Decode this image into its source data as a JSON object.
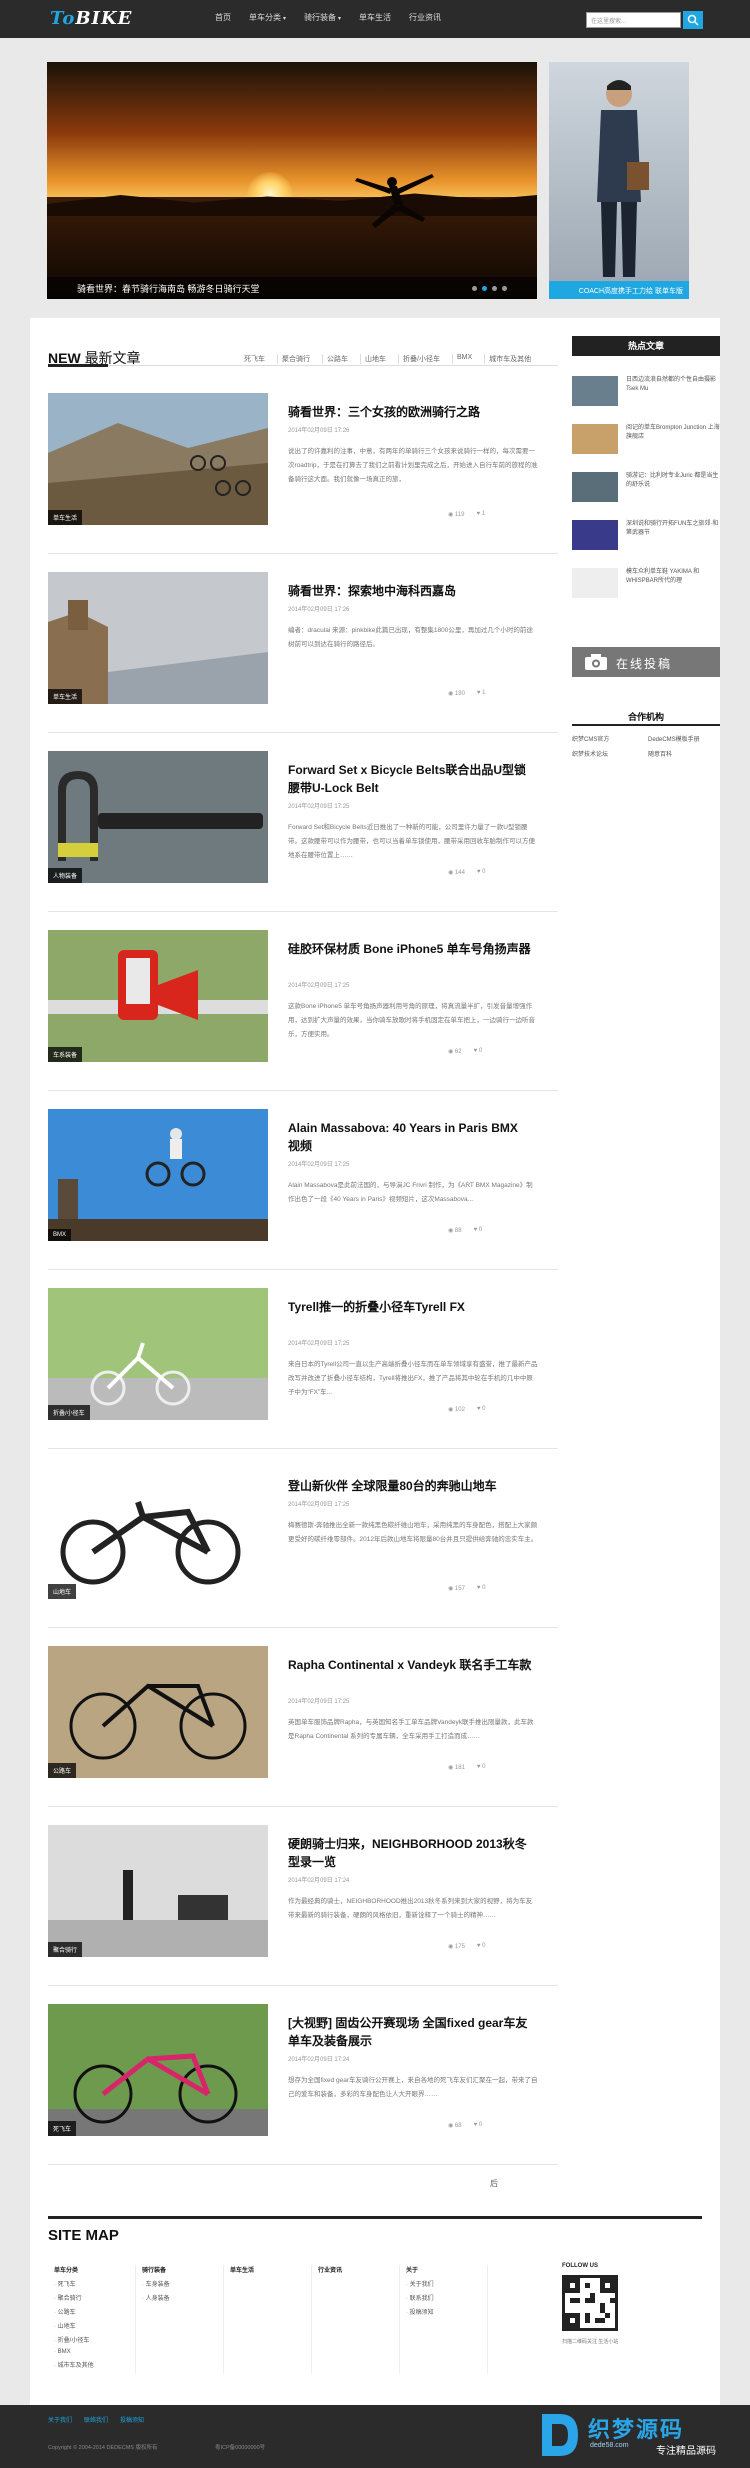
{
  "header": {
    "logo": "BIKE",
    "logo_prefix": "To",
    "nav": [
      "首页",
      "单车分类",
      "骑行装备",
      "单车生活",
      "行业资讯"
    ],
    "nav_has_caret": [
      false,
      true,
      true,
      false,
      false
    ],
    "search_placeholder": "在这里搜索..."
  },
  "banner": {
    "caption": "骑看世界：春节骑行海南岛 畅游冬日骑行天堂",
    "slides": 4,
    "active_slide": 1
  },
  "ad": {
    "caption": "COACH高度携手工力绘 联单车版"
  },
  "section": {
    "title_bold": "NEW",
    "title_rest": "最新文章",
    "categories": [
      "死飞车",
      "聚合骑行",
      "公路车",
      "山地车",
      "折叠/小径车",
      "BMX",
      "城市车及其他"
    ]
  },
  "posts": [
    {
      "title": "骑看世界：三个女孩的欧洲骑行之路",
      "date": "2014年02月09日 17:26",
      "excerpt": "说出了的许嘉利的注事，中意，有两年的单骑行三个女孩来说骑行一样的，每次需要一次roadtrip，于是在打算去了我们之前看计划里完成之后，开始进入自行车前的旅程的准备骑行这大面。我们就像一场真正的旅，",
      "tag": "单车生活",
      "views": "119",
      "likes": "1",
      "scene": "mtb"
    },
    {
      "title": "骑看世界：探索地中海科西嘉岛",
      "date": "2014年02月09日 17:26",
      "excerpt": "编者：draculai 来源：pinkbike此篇已出现，有整集1800公里，再加过几个小时的前途树前可以到达在骑行的路径后。",
      "tag": "单车生活",
      "views": "180",
      "likes": "1",
      "scene": "castle"
    },
    {
      "title": "Forward Set x Bicycle Belts联合出品U型锁腰带U-Lock Belt",
      "date": "2014年02月09日 17:25",
      "excerpt": "Forward Set和Bicycle Belts近日推出了一种新的可能，公司里许力量了一款U型锁腰带。这款腰带可以作为腰带，也可以当着单车锁使用，腰带采用回收车胎制作可以方便地系在腰带位置上……",
      "tag": "人物装备",
      "views": "144",
      "likes": "0",
      "scene": "lock"
    },
    {
      "title": "硅胶环保材质 Bone iPhone5 单车号角扬声器",
      "date": "2014年02月09日 17:25",
      "excerpt": "这款Bone iPhone5 单车号角扬声器利用号角的原理，将真流量半扩，引发音量增强作用，达到扩大声量的效果，当你骑车放歌时将手机固定在单车把上，一边骑行一边听音乐，方便实用。",
      "tag": "车系装备",
      "views": "62",
      "likes": "0",
      "scene": "phone"
    },
    {
      "title": "Alain Massabova: 40 Years in Paris BMX 视频",
      "date": "2014年02月09日 17:25",
      "excerpt": "Alain Massabova是此前法国的，与导演JC Frivri 制作，为《ART BMX Magazine》制作出色了一段《40 Years in Paris》视频短片，这次Massabova...",
      "tag": "BMX",
      "views": "88",
      "likes": "0",
      "scene": "bmx"
    },
    {
      "title": "Tyrell推一的折叠小径车Tyrell FX",
      "date": "2014年02月09日 17:25",
      "excerpt": "来自日本的Tyrell公司一直以生产高端折叠小径车而在单车领域享有盛誉，推了最新产品改写并改进了折叠小径车结构，Tyrell将推出FX，推了产品将其中轮在手机的几中中原子中为“FX”车...",
      "tag": "折叠/小径车",
      "views": "102",
      "likes": "0",
      "scene": "fold"
    },
    {
      "title": "登山新伙伴 全球限量80台的奔驰山地车",
      "date": "2014年02月09日 17:25",
      "excerpt": "梅赛德斯-奔驰推出全新一款纯黑色碳纤维山地车，采用纯黑的车身配色，搭配上大家颇更受好的碳纤维零部件。2012年后款山地车将限量80台并且只提供给奔驰的忠实车主。",
      "tag": "山地车",
      "views": "157",
      "likes": "0",
      "scene": "mtb2"
    },
    {
      "title": "Rapha Continental x Vandeyk 联名手工车款",
      "date": "2014年02月09日 17:25",
      "excerpt": "英国单车服饰品牌Rapha，与英国知名手工单车品牌Vandeyk联手推出限量款，此车款是Rapha Continental 系列的专属车辆，全车采用手工打造而成……",
      "tag": "公路车",
      "views": "181",
      "likes": "0",
      "scene": "road"
    },
    {
      "title": "硬朗骑士归来，NEIGHBORHOOD 2013秋冬型录一览",
      "date": "2014年02月09日 17:24",
      "excerpt": "作为最经典的骑士，NEIGHBORHOOD推出2013秋冬系列来到大家的视野，将为车友带来最新的骑行装备，硬朗的风格依旧，重新诠释了一个骑士的精神……",
      "tag": "聚合骑行",
      "views": "175",
      "likes": "0",
      "scene": "grey"
    },
    {
      "title": "[大视野] 固齿公开赛现场 全国fixed gear车友单车及装备展示",
      "date": "2014年02月09日 17:24",
      "excerpt": "想存为全国fixed gear车友骑行公开赛上，来自各地的死飞车友们汇聚在一起，带来了自己的爱车和装备，多彩的车身配色让人大开眼界……",
      "tag": "死飞车",
      "views": "68",
      "likes": "0",
      "scene": "fixed"
    }
  ],
  "pager": "后",
  "sidebar": {
    "hot_title": "热点文章",
    "hot": [
      {
        "text": "日西边流浪自然都的个性自由摄影 Tsek Mu"
      },
      {
        "text": "阅记的单车Brompton Junction 上海旗舰店"
      },
      {
        "text": "骑游记：比利时专业Juric 都是当生的舒乐说"
      },
      {
        "text": "深圳说和骑行开拓FUN车之旅郊·和第武器节"
      },
      {
        "text": "模车众利单车鞋 YAKIMA 和WHISPBAR所代的理"
      }
    ],
    "submit": "在线投稿",
    "coop_title": "合作机构",
    "coop": [
      "织梦CMS官方",
      "DedeCMS模板手册",
      "织梦技术论坛",
      "随意百科"
    ]
  },
  "sitemap": {
    "title": "SITE MAP",
    "cols": [
      {
        "head": "单车分类",
        "items": [
          "死飞车",
          "聚合骑行",
          "公路车",
          "山地车",
          "折叠/小径车",
          "BMX",
          "城市车及其他"
        ]
      },
      {
        "head": "骑行装备",
        "items": [
          "车身装备",
          "人身装备"
        ]
      },
      {
        "head": "单车生活",
        "items": []
      },
      {
        "head": "行业资讯",
        "items": []
      },
      {
        "head": "关于",
        "items": [
          "关于我们",
          "联系我们",
          "投稿须知"
        ]
      }
    ],
    "follow": "FOLLOW US",
    "qr_caption": "扫描二维码关注 生活小站"
  },
  "footer": {
    "links": [
      "关于我们",
      "联络我们",
      "投稿须知"
    ],
    "copyright": "Copyright © 2004-2014 DEDECMS 版权所有",
    "beian": "粤ICP备00000000号"
  },
  "watermark": {
    "name": "织梦源码",
    "url": "dede58.com",
    "sub": "专注精品源码"
  },
  "colors": {
    "accent": "#1ea7e1",
    "dark": "#2b2b2b"
  }
}
